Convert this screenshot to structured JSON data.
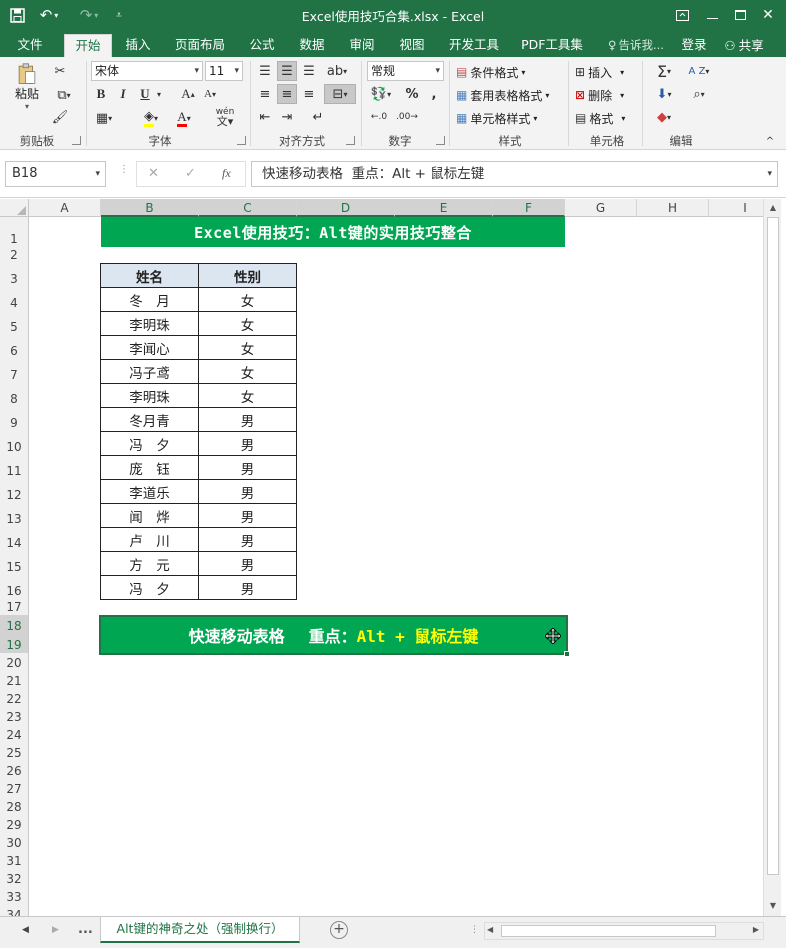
{
  "app": {
    "title": "Excel使用技巧合集.xlsx - Excel",
    "win_icons": [
      "ribbon-display-icon",
      "minimize-icon",
      "maximize-icon",
      "close-icon"
    ]
  },
  "tabs": {
    "items": [
      "文件",
      "开始",
      "插入",
      "页面布局",
      "公式",
      "数据",
      "审阅",
      "视图",
      "开发工具",
      "PDF工具集"
    ],
    "active": "开始",
    "tell_me": "告诉我...",
    "login": "登录",
    "share": "共享"
  },
  "ribbon": {
    "clipboard": {
      "label": "剪贴板",
      "paste": "粘贴"
    },
    "font": {
      "label": "字体",
      "name": "宋体",
      "size": "11",
      "bold": "B",
      "italic": "I",
      "underline": "U",
      "grow": "A",
      "shrink": "A",
      "fill": "A",
      "fontcolor": "A",
      "phonetic": "wén"
    },
    "alignment": {
      "label": "对齐方式"
    },
    "number": {
      "label": "数字",
      "format": "常规",
      "percent": "%",
      "comma": ","
    },
    "styles": {
      "label": "样式",
      "conditional": "条件格式",
      "table": "套用表格格式",
      "cell": "单元格样式"
    },
    "cells": {
      "label": "单元格",
      "insert": "插入",
      "delete": "删除",
      "format": "格式"
    },
    "editing": {
      "label": "编辑",
      "sum": "Σ",
      "sort": "A Z"
    }
  },
  "formula_bar": {
    "name_box": "B18",
    "cancel": "✕",
    "enter": "✓",
    "fx": "fx",
    "content": "快速移动表格  重点：Alt + 鼠标左键"
  },
  "grid": {
    "columns": [
      "A",
      "B",
      "C",
      "D",
      "E",
      "F",
      "G",
      "H",
      "I"
    ],
    "rows": [
      "1",
      "2",
      "3",
      "4",
      "5",
      "6",
      "7",
      "8",
      "9",
      "10",
      "11",
      "12",
      "13",
      "14",
      "15",
      "16",
      "17",
      "18",
      "19",
      "20",
      "21",
      "22",
      "23",
      "24",
      "25",
      "26",
      "27",
      "28",
      "29",
      "30",
      "31",
      "32",
      "33",
      "34"
    ]
  },
  "sheet": {
    "title_banner": "Excel使用技巧：Alt键的实用技巧整合",
    "table": {
      "headers": [
        "姓名",
        "性别"
      ],
      "rows": [
        [
          "冬　月",
          "女"
        ],
        [
          "李明珠",
          "女"
        ],
        [
          "李闻心",
          "女"
        ],
        [
          "冯子鸢",
          "女"
        ],
        [
          "李明珠",
          "女"
        ],
        [
          "冬月青",
          "男"
        ],
        [
          "冯　夕",
          "男"
        ],
        [
          "庞　钰",
          "男"
        ],
        [
          "李道乐",
          "男"
        ],
        [
          "闻　烨",
          "男"
        ],
        [
          "卢　川",
          "男"
        ],
        [
          "方　元",
          "男"
        ],
        [
          "冯　夕",
          "男"
        ]
      ]
    },
    "tip_banner": {
      "part1": "快速移动表格",
      "part2": "重点：",
      "part3": "Alt + 鼠标左键",
      "color_highlight": "#ffff00",
      "color_bg": "#00a651"
    }
  },
  "sheet_tabs": {
    "more": "...",
    "active": "Alt键的神奇之处（强制换行）",
    "add": "+"
  }
}
